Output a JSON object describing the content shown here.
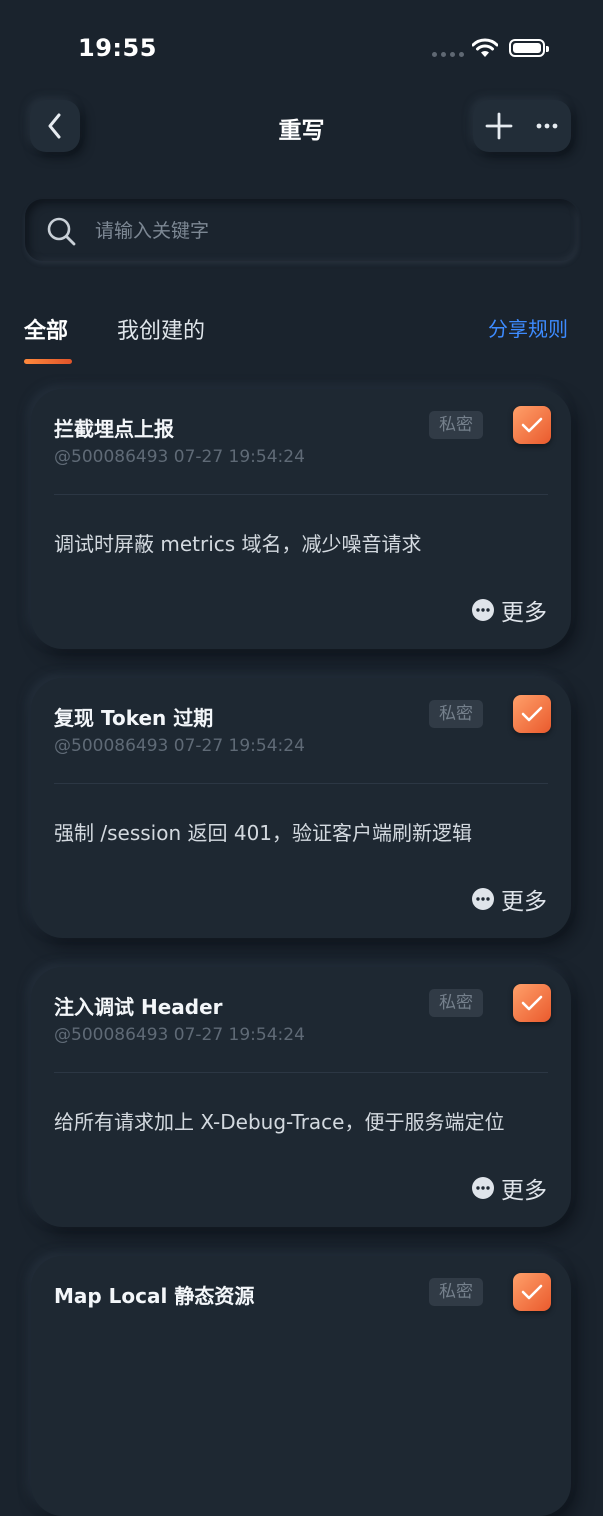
{
  "status": {
    "time": "19:55"
  },
  "nav": {
    "title": "重写"
  },
  "search": {
    "placeholder": "请输入关键字"
  },
  "tabs": [
    {
      "label": "全部",
      "active": true
    },
    {
      "label": "我创建的",
      "active": false
    }
  ],
  "share_rules_label": "分享规则",
  "colors": {
    "accent": "#3d8bff",
    "checkbox": "#f07440",
    "background": "#1a232d"
  },
  "cards": [
    {
      "title": "拦截埋点上报",
      "meta": "@500086493 07-27 19:54:24",
      "badge": "私密",
      "checked": true,
      "description": "调试时屏蔽 metrics 域名，减少噪音请求",
      "more_label": "更多"
    },
    {
      "title": "复现 Token 过期",
      "meta": "@500086493 07-27 19:54:24",
      "badge": "私密",
      "checked": true,
      "description": "强制 /session 返回 401，验证客户端刷新逻辑",
      "more_label": "更多"
    },
    {
      "title": "注入调试 Header",
      "meta": "@500086493 07-27 19:54:24",
      "badge": "私密",
      "checked": true,
      "description": "给所有请求加上 X-Debug-Trace，便于服务端定位",
      "more_label": "更多"
    },
    {
      "title": "Map Local 静态资源",
      "badge": "私密",
      "checked": true
    }
  ]
}
